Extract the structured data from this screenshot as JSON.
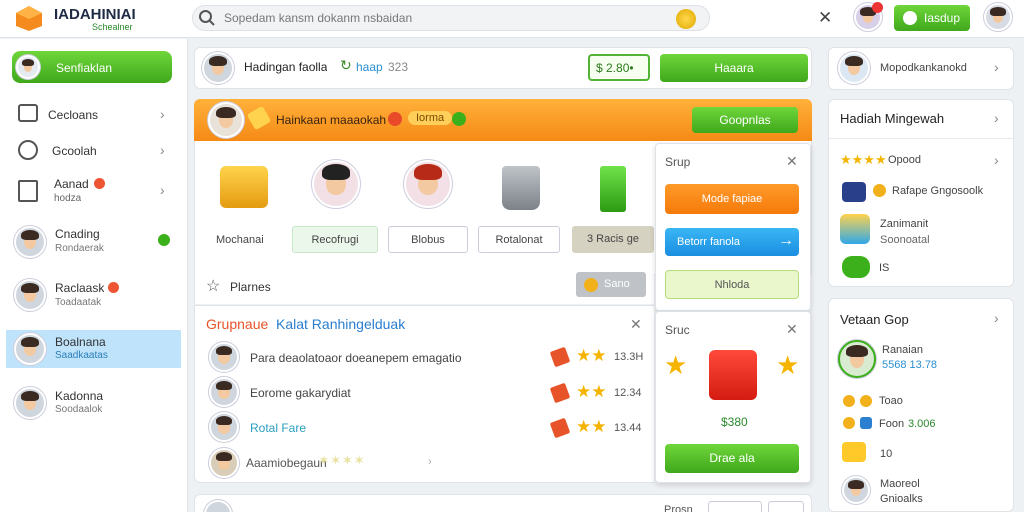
{
  "header": {
    "brand": "IADAHINIAI",
    "brand_sub": "Schealner",
    "search_placeholder": "Sopedam kansm dokanm nsbaidan",
    "play_label": "Iasdup"
  },
  "left": {
    "primary_button": "Senfiaklan",
    "menu": [
      {
        "label": "Cecloans",
        "sub": ""
      },
      {
        "label": "Gcoolah",
        "sub": ""
      },
      {
        "label": "Aanad",
        "sub": "hodza"
      }
    ],
    "users": [
      {
        "name": "Cnading",
        "sub": "Rondaerak"
      },
      {
        "name": "Raclaask",
        "sub": "Toadaatak"
      },
      {
        "name": "Boalnana",
        "sub": "Saadkaatas"
      },
      {
        "name": "Kadonna",
        "sub": "Soodaalok"
      }
    ]
  },
  "top_bar": {
    "name": "Hadingan faolla",
    "tag": "haap",
    "tag_num": "323",
    "price": "$ 2.80•",
    "action": "Haaara"
  },
  "banner": {
    "title": "Hainkaan maaaokah",
    "pill": "Iorma",
    "action": "Goopnlas"
  },
  "items": [
    {
      "label": "Mochanai"
    },
    {
      "label": "Recofrugi"
    },
    {
      "label": "Blobus"
    },
    {
      "label": "Rotalonat"
    },
    {
      "label": "3 Racis ge"
    }
  ],
  "section": {
    "label": "Plarnes",
    "button": "Sano"
  },
  "group": {
    "title_a": "Grupnaue",
    "title_b": "Kalat Ranhingelduak",
    "rows": [
      {
        "text": "Para deaolatoaor doeanepem emagatio",
        "score": "13.3H"
      },
      {
        "text": "Eorome gakarydiat",
        "score": "12.34"
      },
      {
        "text": "Rotal Fare",
        "score": "13.44"
      },
      {
        "text": "Aaamiobegaun",
        "score": ""
      }
    ]
  },
  "popup1": {
    "title": "Srup",
    "buttons": [
      "Mode fapiae",
      "Betorr fanola",
      "Nhloda"
    ]
  },
  "popup2": {
    "title": "Sruc",
    "amount": "$380",
    "button": "Drae ala"
  },
  "bottom_bar": {
    "label": "Prosn"
  },
  "right": {
    "top_item": "Mopodkankanokd",
    "weekly": {
      "title": "Hadiah Mingewah",
      "items": [
        {
          "label": "Opood",
          "sub": ""
        },
        {
          "label": "Rafape Gngosoolk",
          "sub": ""
        },
        {
          "label": "Zanimanit",
          "sub": "Soonoatal"
        },
        {
          "label": "IS",
          "sub": ""
        }
      ]
    },
    "group": {
      "title": "Vetaan Gop",
      "user_name": "Ranaian",
      "user_score": "5568 13.78",
      "items": [
        {
          "label": "Toao",
          "value": ""
        },
        {
          "label": "Foon",
          "value": "3.006"
        },
        {
          "label": "10",
          "value": ""
        },
        {
          "label": "Maoreol",
          "value": "Gnioalks"
        }
      ]
    }
  }
}
